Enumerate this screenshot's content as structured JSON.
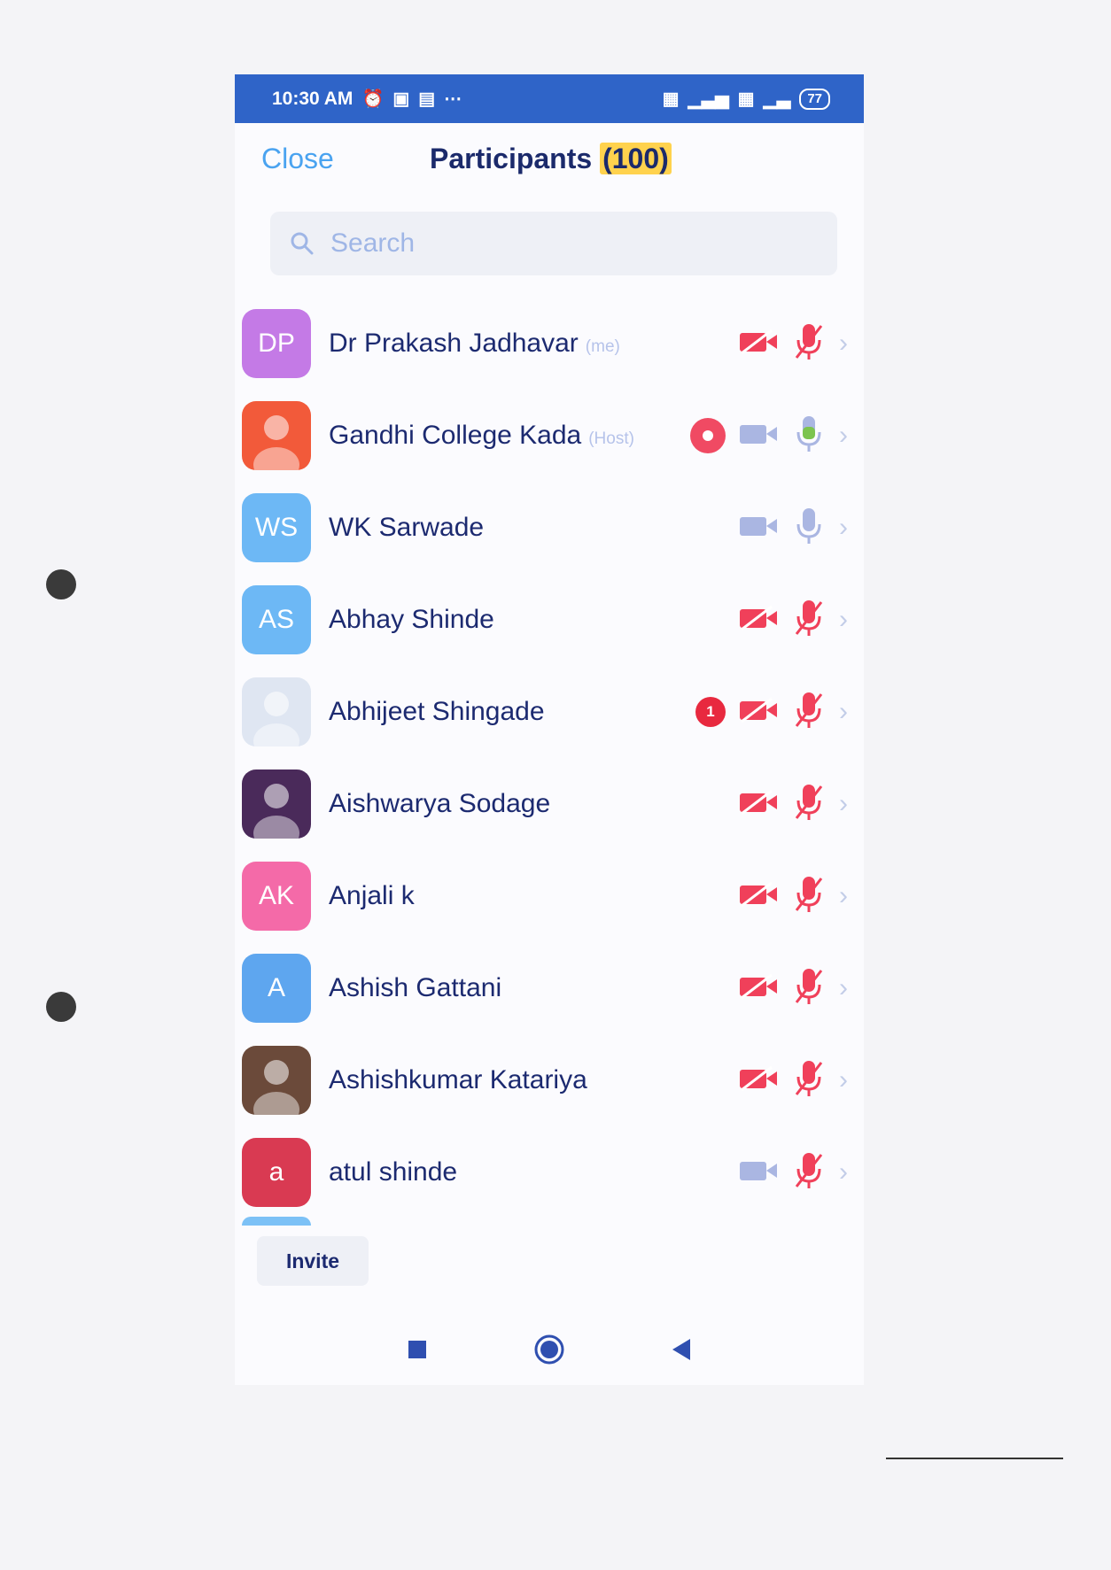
{
  "statusbar": {
    "time": "10:30 AM",
    "left_icons": [
      "alarm-icon",
      "message-icon",
      "lr-app-icon",
      "more-dots-icon"
    ],
    "right_icons": [
      "sim1-icon",
      "signal-icon",
      "sim2-icon",
      "signal-icon"
    ],
    "battery": "77"
  },
  "header": {
    "close_label": "Close",
    "title": "Participants",
    "count": "(100)"
  },
  "search": {
    "placeholder": "Search"
  },
  "participants": [
    {
      "initials": "DP",
      "name": "Dr Prakash Jadhavar",
      "tag": "(me)",
      "avatar_color": "#c47ae6",
      "video": "off",
      "mic": "muted"
    },
    {
      "initials": "",
      "name": "Gandhi College Kada",
      "tag": "(Host)",
      "avatar_color": "#f25a3a",
      "avatar_image": "host-photo",
      "recording": true,
      "video": "on",
      "mic": "speaking"
    },
    {
      "initials": "WS",
      "name": "WK Sarwade",
      "tag": "",
      "avatar_color": "#6db8f5",
      "video": "on",
      "mic": "on"
    },
    {
      "initials": "AS",
      "name": "Abhay Shinde",
      "tag": "",
      "avatar_color": "#6db8f5",
      "video": "off",
      "mic": "muted"
    },
    {
      "initials": "",
      "name": "Abhijeet Shingade",
      "tag": "",
      "avatar_color": "#dfe6f2",
      "avatar_image": "profile-photo",
      "unread": "1",
      "video": "off",
      "mic": "muted"
    },
    {
      "initials": "",
      "name": "Aishwarya Sodage",
      "tag": "",
      "avatar_color": "#4a2a5a",
      "avatar_image": "rose-photo",
      "video": "off",
      "mic": "muted"
    },
    {
      "initials": "AK",
      "name": "Anjali k",
      "tag": "",
      "avatar_color": "#f46aa8",
      "video": "off",
      "mic": "muted"
    },
    {
      "initials": "A",
      "name": "Ashish Gattani",
      "tag": "",
      "avatar_color": "#5ea6ef",
      "video": "off",
      "mic": "muted"
    },
    {
      "initials": "",
      "name": "Ashishkumar Katariya",
      "tag": "",
      "avatar_color": "#6b4a3a",
      "avatar_image": "person-photo",
      "video": "off",
      "mic": "muted"
    },
    {
      "initials": "a",
      "name": "atul shinde",
      "tag": "",
      "avatar_color": "#d93a52",
      "video": "on",
      "mic": "muted"
    }
  ],
  "footer": {
    "invite_label": "Invite"
  },
  "navbar": {
    "items": [
      "recent-apps-icon",
      "home-icon",
      "back-icon"
    ]
  },
  "colors": {
    "statusbar": "#2f64c8",
    "accent": "#4aa3f0",
    "muted_red": "#f0405a",
    "icon_gray": "#aab6e2",
    "speaking_green": "#7cc44e"
  }
}
